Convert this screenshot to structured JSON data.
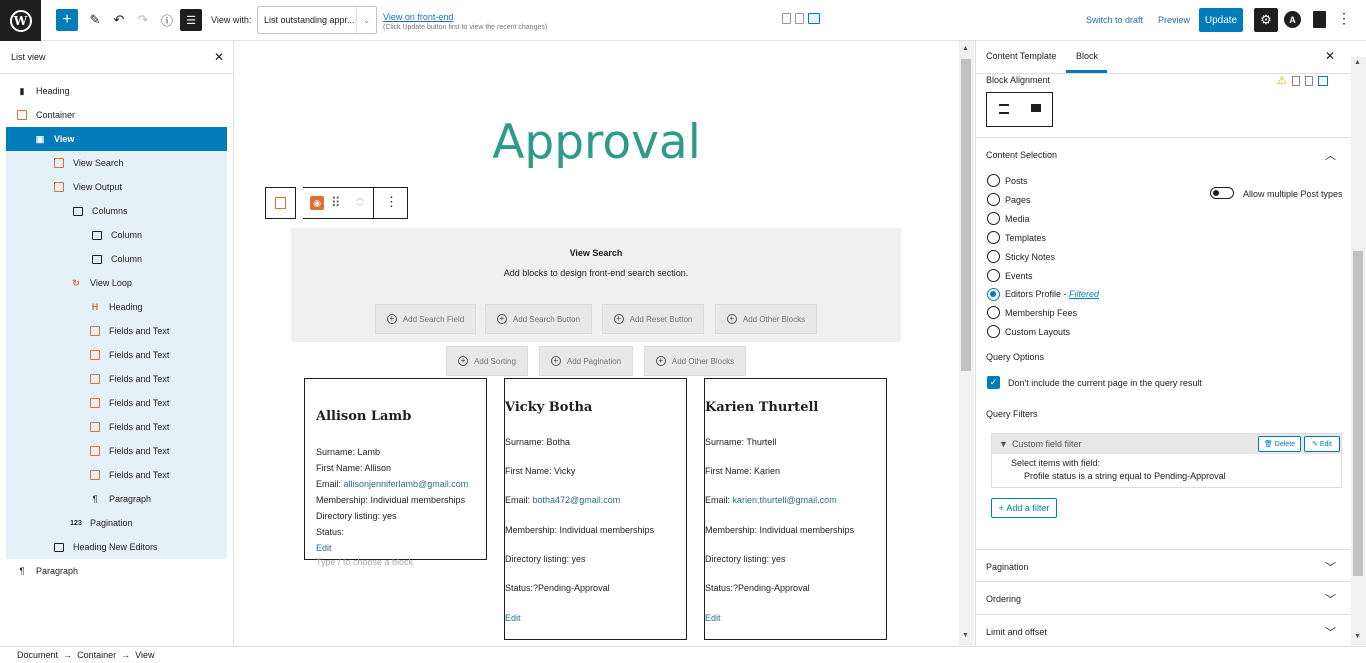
{
  "toolbar": {
    "view_with_label": "View with:",
    "view_with_value": "List outstanding appr...",
    "view_on_front_end": "View on front-end",
    "view_note": "(Click Update button first to view the recent changes)",
    "switch_to_draft": "Switch to draft",
    "preview": "Preview",
    "update": "Update"
  },
  "listview": {
    "title": "List view",
    "items": [
      {
        "label": "Heading",
        "icon": "bookmark-icon"
      },
      {
        "label": "Container",
        "icon": "container-icon"
      },
      {
        "label": "View",
        "icon": "calendar-icon"
      },
      {
        "label": "View Search",
        "icon": "search-icon"
      },
      {
        "label": "View Output",
        "icon": "eye-icon"
      },
      {
        "label": "Columns",
        "icon": "columns-icon"
      },
      {
        "label": "Column",
        "icon": "column-icon"
      },
      {
        "label": "Column",
        "icon": "column-icon"
      },
      {
        "label": "View Loop",
        "icon": "loop-icon"
      },
      {
        "label": "Heading",
        "icon": "heading-icon"
      },
      {
        "label": "Fields and Text",
        "icon": "fields-icon"
      },
      {
        "label": "Fields and Text",
        "icon": "fields-icon"
      },
      {
        "label": "Fields and Text",
        "icon": "fields-icon"
      },
      {
        "label": "Fields and Text",
        "icon": "fields-icon"
      },
      {
        "label": "Fields and Text",
        "icon": "fields-icon"
      },
      {
        "label": "Fields and Text",
        "icon": "fields-icon"
      },
      {
        "label": "Fields and Text",
        "icon": "fields-icon"
      },
      {
        "label": "Paragraph",
        "icon": "pilcrow-icon"
      },
      {
        "label": "Pagination",
        "icon": "numbers-icon"
      },
      {
        "label": "Heading New Editors",
        "icon": "heading-box-icon"
      },
      {
        "label": "Paragraph",
        "icon": "pilcrow-icon"
      }
    ]
  },
  "canvas": {
    "title": "Approval",
    "view_search_title": "View Search",
    "view_search_sub": "Add blocks to design front-end search section.",
    "search_buttons": [
      "Add Search Field",
      "Add Search Button",
      "Add Reset Button",
      "Add Other Blocks"
    ],
    "loop_buttons": [
      "Add Sorting",
      "Add Pagination",
      "Add Other Blocks"
    ],
    "block_hint": "Type / to choose a block",
    "cards": [
      {
        "name": "Allison Lamb",
        "surname": "Surname: Lamb",
        "first_name": "First Name: Allison",
        "email_label": "Email: ",
        "email": "allisonjenniferlamb@gmail.com",
        "membership": "Membership: Individual memberships",
        "directory": "Directory listing: yes",
        "status": "Status:",
        "edit": "Edit"
      },
      {
        "name": "Vicky Botha",
        "surname": "Surname: Botha",
        "first_name": "First Name: Vicky",
        "email_label": "Email: ",
        "email": "botha472@gmail.com",
        "membership": "Membership: Individual memberships",
        "directory": "Directory listing: yes",
        "status": "Status:?Pending-Approval",
        "edit": "Edit"
      },
      {
        "name": "Karien Thurtell",
        "surname": "Surname: Thurtell",
        "first_name": "First Name: Karien",
        "email_label": "Email: ",
        "email": "karien.thurtell@gmail.com",
        "membership": "Membership: Individual memberships",
        "directory": "Directory listing: yes",
        "status": "Status:?Pending-Approval",
        "edit": "Edit"
      }
    ]
  },
  "sidebar": {
    "tabs": [
      "Content Template",
      "Block"
    ],
    "block_alignment": "Block Alignment",
    "content_selection": "Content Selection",
    "post_types": [
      "Posts",
      "Pages",
      "Media",
      "Templates",
      "Sticky Notes",
      "Events",
      "Editors Profile - ",
      "Membership Fees",
      "Custom Layouts"
    ],
    "filtered": "Filtered",
    "selected_index": 6,
    "allow_multiple": "Allow multiple Post types",
    "query_options": "Query Options",
    "dont_include": "Don't include the current page in the query result",
    "query_filters": "Query Filters",
    "filter_title": "Custom field filter",
    "delete": "Delete",
    "edit": "Edit",
    "filter_line1": "Select items with field:",
    "filter_line2": "Profile status is a string equal to Pending-Approval",
    "add_filter": "Add a filter",
    "panels": [
      "Pagination",
      "Ordering",
      "Limit and offset"
    ]
  },
  "footer": {
    "breadcrumb": [
      "Document",
      "Container",
      "View"
    ]
  },
  "colors": {
    "accent": "#007cba",
    "title_teal": "#2d9c86",
    "block_orange": "#e26f2d"
  }
}
